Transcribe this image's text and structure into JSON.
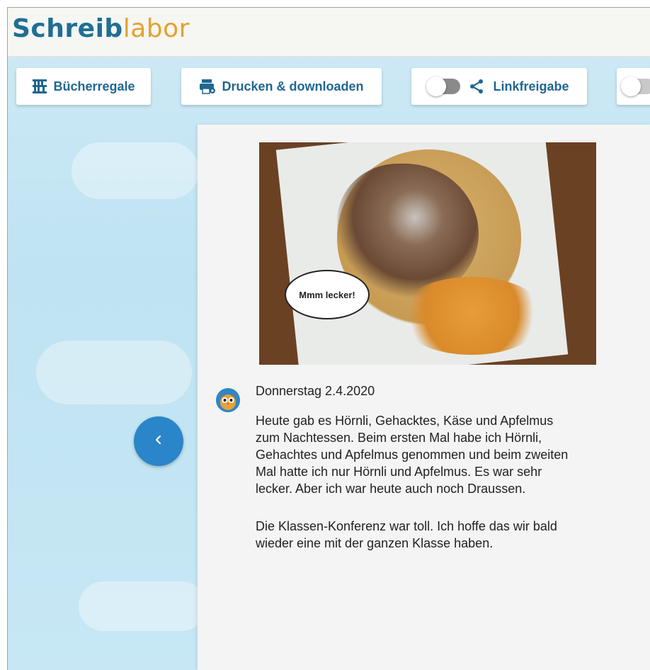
{
  "app": {
    "logo_part1": "Schreib",
    "logo_part2": "labor"
  },
  "toolbar": {
    "bookshelves_label": "Bücherregale",
    "print_download_label": "Drucken & downloaden",
    "link_share_label": "Linkfreigabe",
    "link_share_enabled": false
  },
  "entry": {
    "speech_bubble": "Mmm lecker!",
    "date": "Donnerstag 2.4.2020",
    "paragraph1_lines": [
      "Heute gab es Hörnli, Gehacktes, Käse und Apfelmus",
      "zum Nachtessen. Beim ersten Mal habe ich Hörnli,",
      "Gehachtes und Apfelmus genommen und beim zweiten",
      "Mal hatte ich nur Hörnli und Apfelmus. Es war sehr",
      "lecker. Aber ich war heute auch noch Draussen."
    ],
    "paragraph2_lines": [
      "Die Klassen-Konferenz war toll. Ich hoffe das wir bald",
      "wieder eine mit der ganzen Klasse haben."
    ]
  },
  "icons": {
    "bookshelves": "bookshelf-icon",
    "print": "printer-icon",
    "share": "share-icon",
    "prev": "chevron-left-icon",
    "avatar": "owl-avatar-icon"
  }
}
